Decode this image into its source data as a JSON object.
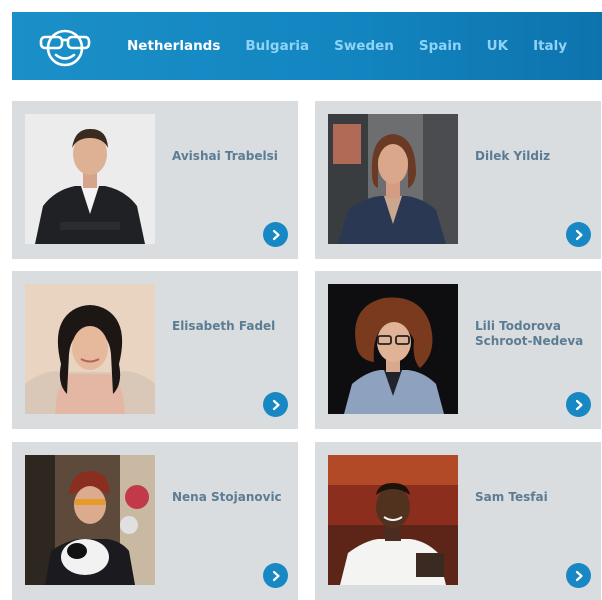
{
  "nav": {
    "logo_icon": "sunglasses-face-icon",
    "items": [
      {
        "label": "Netherlands",
        "active": true
      },
      {
        "label": "Bulgaria",
        "active": false
      },
      {
        "label": "Sweden",
        "active": false
      },
      {
        "label": "Spain",
        "active": false
      },
      {
        "label": "UK",
        "active": false
      },
      {
        "label": "Italy",
        "active": false
      }
    ]
  },
  "cards": [
    {
      "name": "Avishai Trabelsi"
    },
    {
      "name": "Dilek Yildiz"
    },
    {
      "name": "Elisabeth Fadel"
    },
    {
      "name": "Lili Todorova Schroot-Nedeva"
    },
    {
      "name": "Nena Stojanovic"
    },
    {
      "name": "Sam Tesfai"
    }
  ],
  "colors": {
    "nav_bg": "#1386c1",
    "nav_text": "#8fd4f6",
    "nav_active": "#ffffff",
    "card_bg": "#d9dde0",
    "name_text": "#5c7c93",
    "arrow_bg": "#1788c3"
  },
  "icons": {
    "arrow": "chevron-right-circle-icon"
  }
}
